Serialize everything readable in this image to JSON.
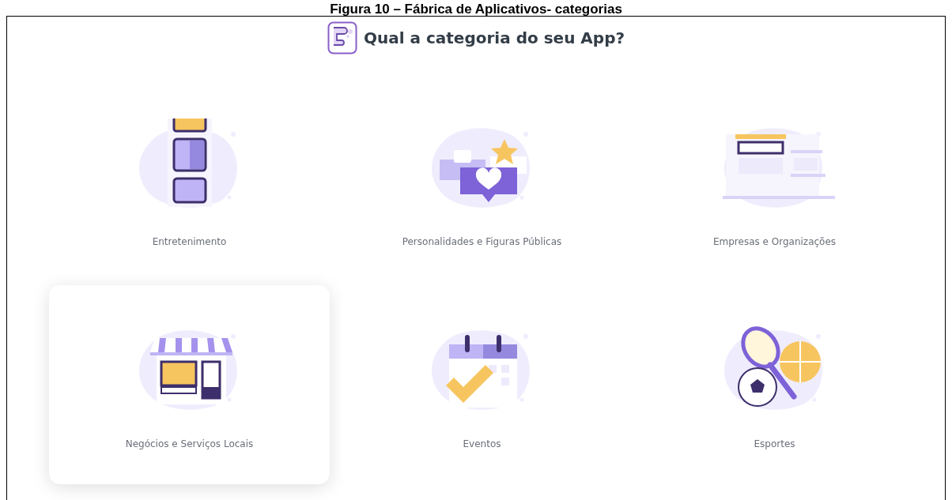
{
  "caption": "Figura 10 – Fábrica de Aplicativos- categorias",
  "heading": "Qual a categoria do seu App?",
  "categories": [
    {
      "label": "Entretenimento",
      "selected": false
    },
    {
      "label": "Personalidades e Figuras Públicas",
      "selected": false
    },
    {
      "label": "Empresas e Organizações",
      "selected": false
    },
    {
      "label": "Negócios e Serviços Locais",
      "selected": true
    },
    {
      "label": "Eventos",
      "selected": false
    },
    {
      "label": "Esportes",
      "selected": false
    }
  ]
}
